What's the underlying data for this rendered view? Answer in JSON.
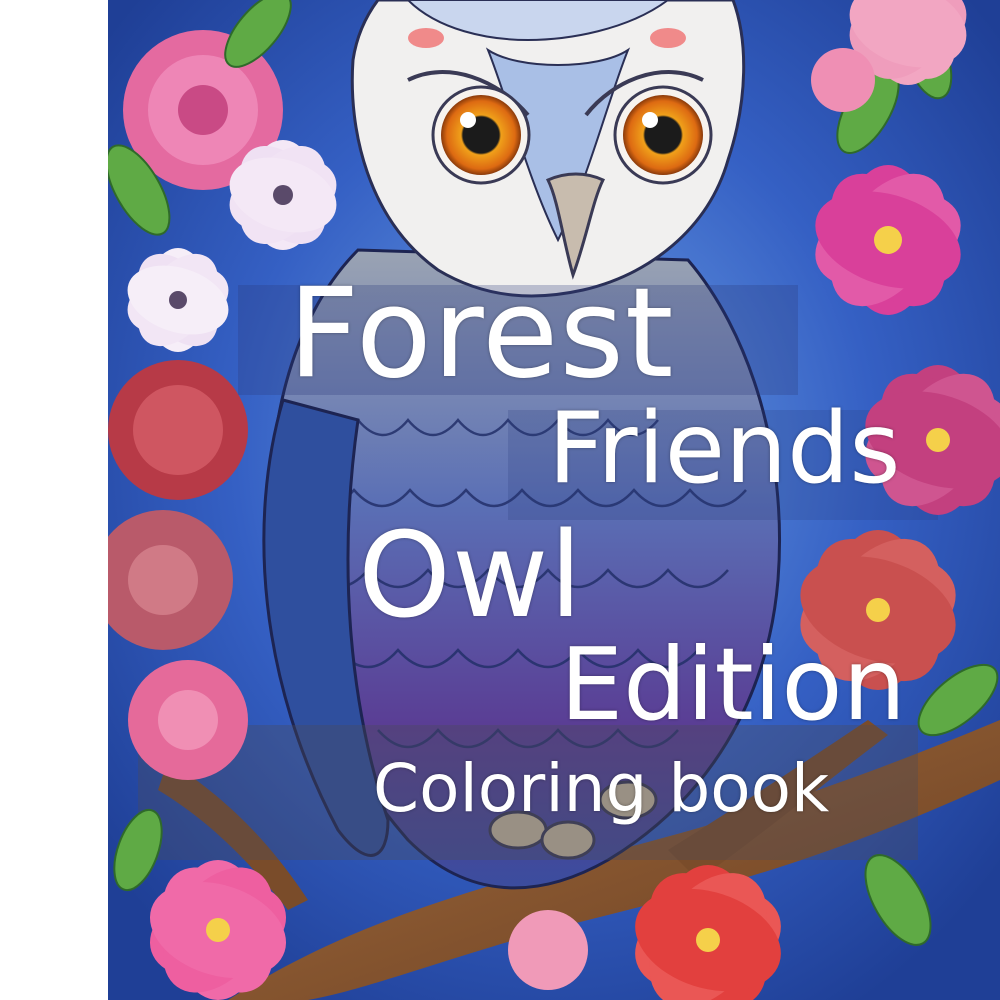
{
  "cover": {
    "title_line_1": "Forest",
    "title_line_2": "Friends",
    "title_line_3": "Owl",
    "title_line_4": "Edition",
    "subtitle": "Coloring book"
  },
  "colors": {
    "background": "#2f55b8",
    "owl_face": "#f1f0ef",
    "owl_eye": "#e9861a",
    "owl_body_blue": "#3d5fae",
    "owl_body_purple": "#5b3f8f",
    "flower_pink": "#e8559a",
    "flower_red": "#c74f4f",
    "leaf_green": "#5faa45",
    "branch_brown": "#8a5a34",
    "text": "#ffffff"
  }
}
